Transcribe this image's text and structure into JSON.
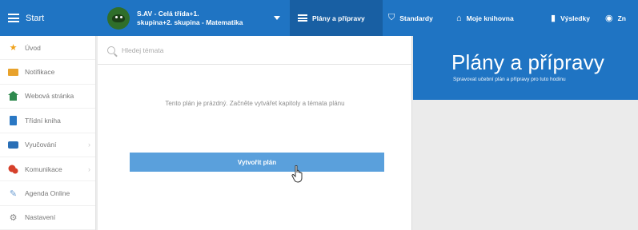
{
  "topbar": {
    "start_label": "Start",
    "class_selector": {
      "line1": "S.AV - Celá třída+1.",
      "line2": "skupina+2. skupina - Matematika"
    },
    "nav": [
      {
        "label": "Plány a přípravy",
        "icon": "list-icon"
      },
      {
        "label": "Standardy",
        "icon": "shield-icon"
      },
      {
        "label": "Moje knihovna",
        "icon": "library-icon"
      },
      {
        "label": "Výsledky",
        "icon": "bar-chart-icon"
      },
      {
        "label": "Zn",
        "icon": "globe-icon"
      }
    ]
  },
  "sidebar": {
    "items": [
      {
        "label": "Úvod",
        "icon": "star-icon",
        "color": "#f0a21b"
      },
      {
        "label": "Notifikace",
        "icon": "envelope-icon",
        "color": "#e8a22c"
      },
      {
        "label": "Webová stránka",
        "icon": "home-icon",
        "color": "#2f8a4e"
      },
      {
        "label": "Třídní kniha",
        "icon": "book-icon",
        "color": "#2a78c4"
      },
      {
        "label": "Vyučování",
        "icon": "briefcase-icon",
        "color": "#2a6fb6",
        "has_submenu": true
      },
      {
        "label": "Komunikace",
        "icon": "chat-icon",
        "color": "#d6402b",
        "has_submenu": true
      },
      {
        "label": "Agenda Online",
        "icon": "pencil-icon",
        "color": "#6a9bd1"
      },
      {
        "label": "Nastavení",
        "icon": "gear-icon",
        "color": "#888888"
      }
    ]
  },
  "main": {
    "search_placeholder": "Hledej témata",
    "empty_message": "Tento plán je prázdný. Začněte vytvářet kapitoly a témata plánu",
    "create_button": "Vytvořit plán"
  },
  "right": {
    "title": "Plány a přípravy",
    "subtitle": "Spravovat učební plán a přípravy pro tuto hodinu"
  },
  "colors": {
    "primary": "#1f74c3",
    "button": "#5aa0dc"
  }
}
